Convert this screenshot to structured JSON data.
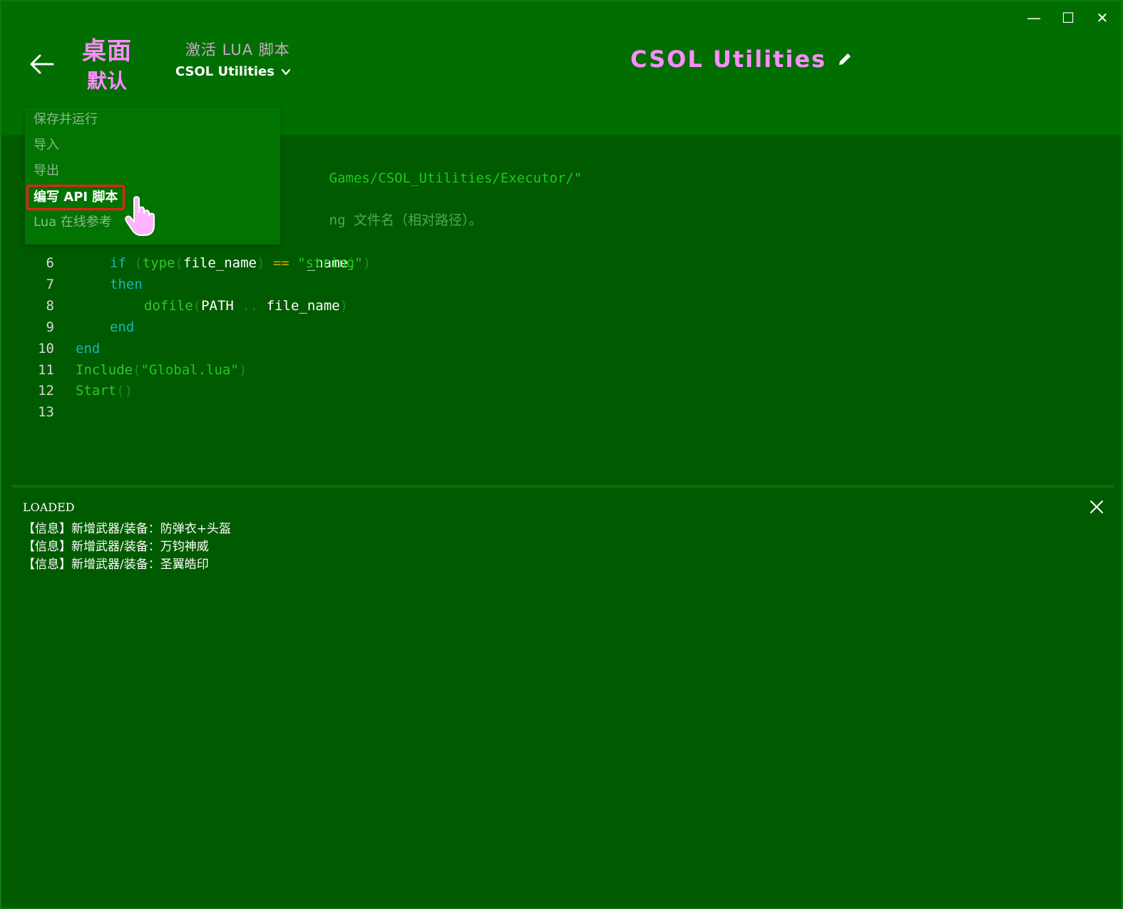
{
  "window": {
    "controls": {
      "minimize": "—",
      "maximize": "☐",
      "close": "✕"
    }
  },
  "header": {
    "device_name": "桌面",
    "profile_name": "默认",
    "script_label": "激活 LUA 脚本",
    "script_selected": "CSOL Utilities",
    "app_title": "CSOL Utilities"
  },
  "menu": {
    "items": [
      {
        "label": "保存并运行"
      },
      {
        "label": "导入"
      },
      {
        "label": "导出"
      },
      {
        "label": "编写 API 脚本"
      },
      {
        "label": "Lua 在线参考"
      }
    ]
  },
  "editor": {
    "visible_fragments": {
      "line2_path": "Games/CSOL_Utilities/Executor/\"",
      "line4_comment": "ng 文件名（相对路径）。",
      "line5_tail": "_name",
      "line5_paren": ")"
    },
    "lines": [
      {
        "n": "6",
        "indent": 1,
        "tokens": [
          [
            "kw",
            "if"
          ],
          [
            "p",
            " ("
          ],
          [
            "fn",
            "type"
          ],
          [
            "p",
            "("
          ],
          [
            "id",
            "file_name"
          ],
          [
            "p",
            ")"
          ],
          [
            "op",
            " == "
          ],
          [
            "str",
            "\"string\""
          ],
          [
            "p",
            ")"
          ]
        ]
      },
      {
        "n": "7",
        "indent": 1,
        "tokens": [
          [
            "kw",
            "then"
          ]
        ]
      },
      {
        "n": "8",
        "indent": 2,
        "tokens": [
          [
            "fn",
            "dofile"
          ],
          [
            "p",
            "("
          ],
          [
            "id",
            "PATH"
          ],
          [
            "p",
            " .. "
          ],
          [
            "id",
            "file_name"
          ],
          [
            "p",
            ")"
          ]
        ]
      },
      {
        "n": "9",
        "indent": 1,
        "tokens": [
          [
            "kw",
            "end"
          ]
        ]
      },
      {
        "n": "10",
        "indent": 0,
        "tokens": [
          [
            "kw",
            "end"
          ]
        ]
      },
      {
        "n": "11",
        "indent": 0,
        "tokens": [
          [
            "fn",
            "Include"
          ],
          [
            "p",
            "("
          ],
          [
            "str",
            "\"Global.lua\""
          ],
          [
            "p",
            ")"
          ]
        ]
      },
      {
        "n": "12",
        "indent": 0,
        "tokens": [
          [
            "fn",
            "Start"
          ],
          [
            "p",
            "()"
          ]
        ]
      },
      {
        "n": "13",
        "indent": 0,
        "tokens": []
      }
    ]
  },
  "console": {
    "lines": [
      "LOADED",
      "【信息】新增武器/装备：防弹衣+头盔",
      "【信息】新增武器/装备：万钧神威",
      "【信息】新增武器/装备：圣翼皓印"
    ]
  },
  "colors": {
    "background": "#005a00",
    "header": "#006e00",
    "accent_pink": "#ff8cff",
    "menu_bg": "#007300",
    "highlight_red": "#ff1a1a"
  }
}
